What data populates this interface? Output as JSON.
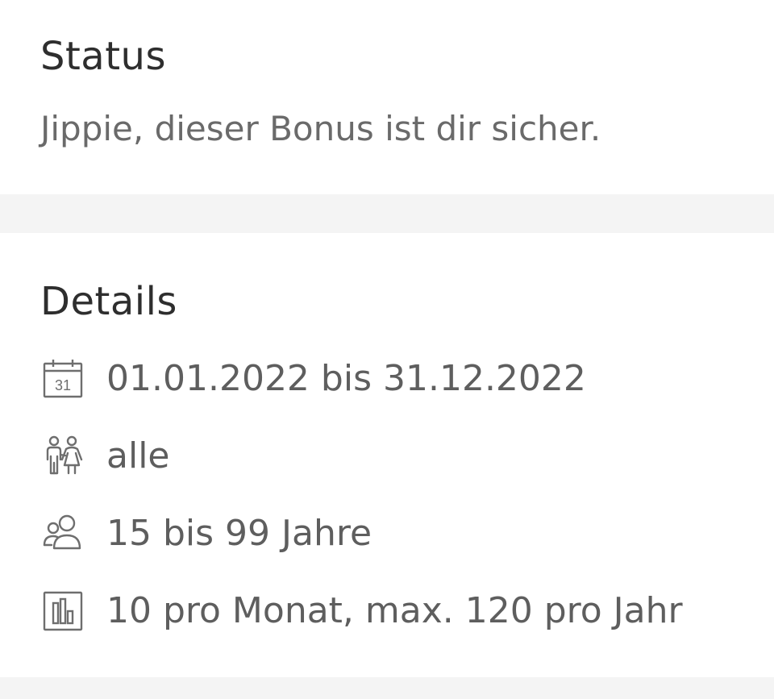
{
  "status": {
    "title": "Status",
    "text": "Jippie, dieser Bonus ist dir sicher."
  },
  "details": {
    "title": "Details",
    "items": [
      {
        "icon": "calendar-icon",
        "label": "01.01.2022 bis 31.12.2022",
        "icon_text": "31"
      },
      {
        "icon": "family-icon",
        "label": "alle"
      },
      {
        "icon": "users-icon",
        "label": "15 bis 99 Jahre"
      },
      {
        "icon": "bar-chart-icon",
        "label": "10 pro Monat, max. 120 pro Jahr"
      }
    ]
  },
  "colors": {
    "background": "#f4f4f4",
    "card": "#ffffff",
    "heading": "#2e2e2e",
    "text": "#5e5e5e",
    "icon": "#6e6e6e"
  }
}
